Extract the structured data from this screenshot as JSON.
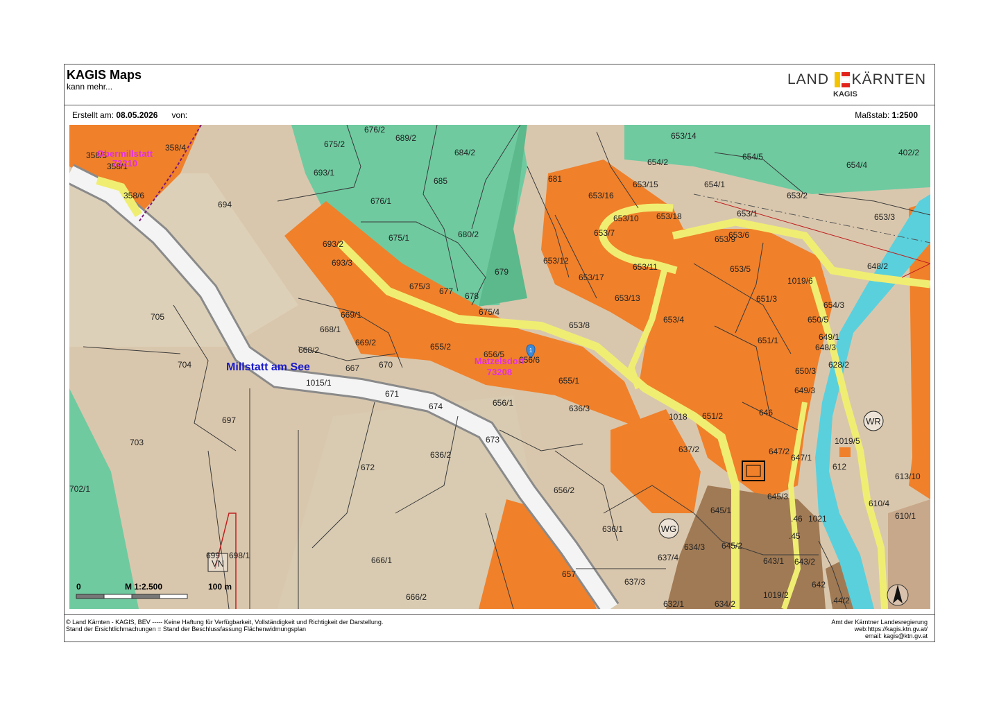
{
  "header": {
    "app_title": "KAGIS Maps",
    "app_subtitle": "kann mehr...",
    "logo_left": "LAND",
    "logo_right": "KÄRNTEN",
    "logo_sub": "KAGIS"
  },
  "meta": {
    "created_label": "Erstellt am:",
    "created_date": "08.05.2026",
    "from_label": "von:",
    "scale_label": "Maßstab:",
    "scale_value": "1:2500"
  },
  "map": {
    "place_name": "Millstatt am See",
    "pink_labels": [
      "Obermillstatt",
      "73210",
      "Matzelsdorf",
      "73208"
    ],
    "scalebar": {
      "start": "0",
      "middle": "M 1:2.500",
      "end": "100 m"
    },
    "zone_labels": [
      "WR",
      "WG",
      "VN"
    ],
    "parcels": [
      "358/5",
      "358/4",
      "358/1",
      "358/6",
      "694",
      "676/2",
      "689/2",
      "675/2",
      "684/2",
      "693/1",
      "685",
      "676/1",
      "681",
      "675/1",
      "680/2",
      "693/2",
      "693/3",
      "679",
      "675/3",
      "677",
      "678",
      "675/4",
      "669/1",
      "668/1",
      "669/2",
      "668/2",
      "667",
      "670",
      "655/2",
      "656/5",
      "656/6",
      "704",
      "705",
      "1015/1",
      "671",
      "674",
      "656/1",
      "655/1",
      "636/3",
      "697",
      "703",
      "673",
      "672",
      "702/1",
      "656/2",
      "666/1",
      "698/1",
      "699",
      "657",
      "666/2",
      "653/14",
      "654/2",
      "654/5",
      "654/4",
      "402/2",
      "653/15",
      "653/16",
      "654/1",
      "653/2",
      "653/10",
      "653/18",
      "653/1",
      "653/3",
      "653/7",
      "653/9",
      "653/6",
      "653/12",
      "653/11",
      "653/5",
      "648/2",
      "653/17",
      "653/13",
      "1019/6",
      "651/3",
      "654/3",
      "650/5",
      "653/4",
      "653/8",
      "651/1",
      "649/1",
      "648/3",
      "628/2",
      "650/3",
      "649/3",
      "646",
      "1018",
      "651/2",
      "636/2",
      "637/2",
      "647/2",
      "647/1",
      "1019/5",
      "612",
      "613/10",
      "645/3",
      "610/4",
      "645/1",
      "610/1",
      ".46",
      "1021",
      ".45",
      "636/1",
      "637/4",
      "634/3",
      "645/2",
      "643/1",
      "643/2",
      "637/3",
      "642",
      "1019/2",
      "632/1",
      "634/2",
      ".44/2"
    ]
  },
  "footer": {
    "left_line1": "© Land Kärnten - KAGIS, BEV ----- Keine Haftung für Verfügbarkeit, Vollständigkeit und Richtigkeit der Darstellung.",
    "left_line2": "Stand der Ersichtlichmachungen = Stand der Beschlussfassung Flächenwidmungsplan",
    "right_line1": "Amt der Kärntner Landesregierung",
    "right_line2": "web:https://kagis.ktn.gv.at/",
    "right_line3": "email: kagis@ktn.gv.at"
  },
  "colors": {
    "building_zone": "#f0802a",
    "forest": "#6fcaa0",
    "road": "#f0ee72",
    "agricultural": "#d9c7ad",
    "water": "#5ad0dc",
    "mixed_zone": "#a07a55"
  }
}
